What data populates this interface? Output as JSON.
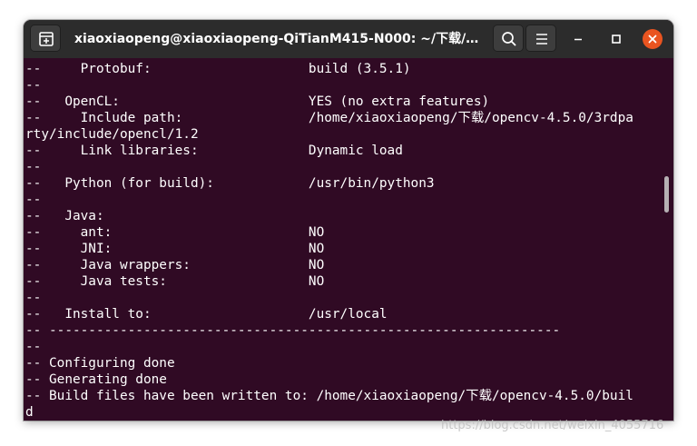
{
  "window": {
    "title": "xiaoxiaopeng@xiaoxiaopeng-QiTianM415-N000: ~/下载/open..."
  },
  "icons": {
    "new_tab": "new-tab-icon",
    "search": "search-icon",
    "menu": "hamburger-menu-icon",
    "minimize": "minimize-icon",
    "maximize": "maximize-icon",
    "close": "close-icon"
  },
  "colors": {
    "terminal_bg": "#300a24",
    "terminal_fg": "#ffffff",
    "titlebar_bg": "#2c2c2c",
    "close_button": "#e95420"
  },
  "terminal": {
    "lines": [
      "--     Protobuf:                    build (3.5.1)",
      "--",
      "--   OpenCL:                        YES (no extra features)",
      "--     Include path:                /home/xiaoxiaopeng/下载/opencv-4.5.0/3rdpa",
      "rty/include/opencl/1.2",
      "--     Link libraries:              Dynamic load",
      "--",
      "--   Python (for build):            /usr/bin/python3",
      "--",
      "--   Java:",
      "--     ant:                         NO",
      "--     JNI:                         NO",
      "--     Java wrappers:               NO",
      "--     Java tests:                  NO",
      "--",
      "--   Install to:                    /usr/local",
      "-- -----------------------------------------------------------------",
      "--",
      "-- Configuring done",
      "-- Generating done",
      "-- Build files have been written to: /home/xiaoxiaopeng/下载/opencv-4.5.0/buil",
      "d"
    ]
  },
  "watermark": "https://blog.csdn.net/weixin_4055716"
}
